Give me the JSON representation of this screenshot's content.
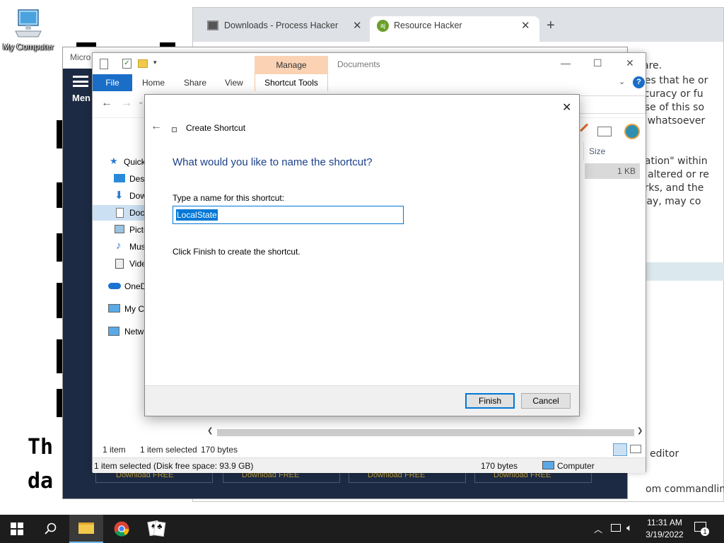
{
  "desktop": {
    "icon_label": "My Computer"
  },
  "browser": {
    "tabs": [
      {
        "label": "Downloads - Process Hacker"
      },
      {
        "label": "Resource Hacker"
      }
    ],
    "doc_lines": [
      "are.",
      "ges that he or",
      "ccuracy or fu",
      "use of this so",
      "y whatsoever",
      "nation\" within",
      "e altered or re",
      "orks, and the",
      "way, may co"
    ],
    "bottom_lines": [
      "editor",
      "om commandline"
    ]
  },
  "background_app": {
    "title": "Micro",
    "menu_label": "Men",
    "big_text": [
      "Th",
      "da"
    ],
    "download_buttons": [
      "Download FREE",
      "Download FREE",
      "Download FREE",
      "Download FREE"
    ]
  },
  "explorer": {
    "ribbon": {
      "file": "File",
      "tabs": [
        "Home",
        "Share",
        "View"
      ],
      "manage": "Manage",
      "shortcut_tools": "Shortcut Tools",
      "title": "Documents"
    },
    "sidebar": [
      {
        "label": "Quick access",
        "icon": "star-icon"
      },
      {
        "label": "Desktop",
        "icon": "desktop-icon"
      },
      {
        "label": "Downloads",
        "icon": "download-icon"
      },
      {
        "label": "Documents",
        "icon": "document-icon"
      },
      {
        "label": "Pictures",
        "icon": "picture-icon"
      },
      {
        "label": "Music",
        "icon": "music-icon"
      },
      {
        "label": "Videos",
        "icon": "video-icon"
      },
      {
        "label": "OneDrive",
        "icon": "cloud-icon"
      },
      {
        "label": "My Computer",
        "icon": "computer-icon"
      },
      {
        "label": "Network",
        "icon": "network-icon"
      }
    ],
    "column_header": "Size",
    "file_size": "1 KB",
    "status_items": "1 item",
    "status_selected": "1 item selected",
    "status_bytes": "170 bytes",
    "status_bar": "1 item selected (Disk free space: 93.9 GB)",
    "status_bar_bytes": "170 bytes",
    "status_bar_location": "Computer"
  },
  "dialog": {
    "title": "Create Shortcut",
    "heading": "What would you like to name the shortcut?",
    "field_label": "Type a name for this shortcut:",
    "field_value": "LocalState",
    "instruction": "Click Finish to create the shortcut.",
    "finish_label": "Finish",
    "cancel_label": "Cancel"
  },
  "taskbar": {
    "time": "11:31 AM",
    "date": "3/19/2022",
    "notification_count": "1"
  },
  "colors": {
    "accent": "#0078d7",
    "file_tab": "#1a6ec7",
    "manage_tab": "#fbd3b4",
    "taskbar": "#1d1d1d"
  }
}
